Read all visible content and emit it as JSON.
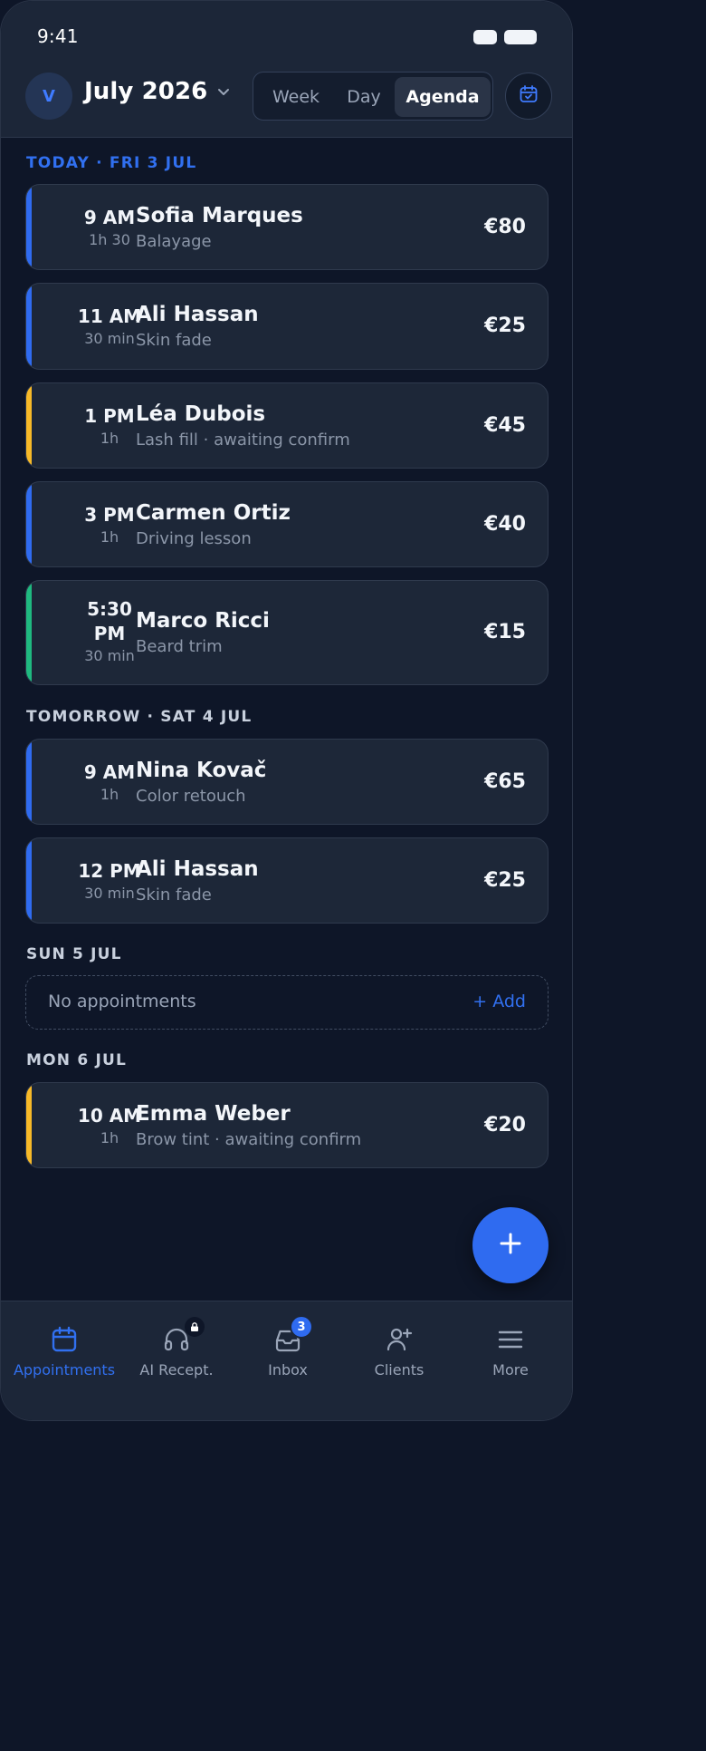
{
  "status_bar": {
    "time": "9:41"
  },
  "header": {
    "avatar_initial": "V",
    "month": "July 2026",
    "views": [
      "Week",
      "Day",
      "Agenda"
    ],
    "active_view": "Agenda"
  },
  "sections": [
    {
      "label": "TODAY · FRI 3 JUL",
      "appointments": [
        {
          "time": "9 AM",
          "duration": "1h 30",
          "client": "Sofia Marques",
          "service": "Balayage",
          "price": "€80",
          "status_color": "#2f6bf0"
        },
        {
          "time": "11 AM",
          "duration": "30 min",
          "client": "Ali Hassan",
          "service": "Skin fade",
          "price": "€25",
          "status_color": "#2f6bf0"
        },
        {
          "time": "1 PM",
          "duration": "1h",
          "client": "Léa Dubois",
          "service": "Lash fill · awaiting confirm",
          "price": "€45",
          "status_color": "#f7b928"
        },
        {
          "time": "3 PM",
          "duration": "1h",
          "client": "Carmen Ortiz",
          "service": "Driving lesson",
          "price": "€40",
          "status_color": "#2f6bf0"
        },
        {
          "time": "5:30 PM",
          "time_line1": "5:30",
          "time_line2": "PM",
          "duration": "30 min",
          "client": "Marco Ricci",
          "service": "Beard trim",
          "price": "€15",
          "status_color": "#1fb980"
        }
      ]
    },
    {
      "label": "TOMORROW · SAT 4 JUL",
      "appointments": [
        {
          "time": "9 AM",
          "duration": "1h",
          "client": "Nina Kovač",
          "service": "Color retouch",
          "price": "€65",
          "status_color": "#2f6bf0"
        },
        {
          "time": "12 PM",
          "duration": "30 min",
          "client": "Ali Hassan",
          "service": "Skin fade",
          "price": "€25",
          "status_color": "#2f6bf0"
        }
      ]
    },
    {
      "label": "SUN 5 JUL",
      "empty_text": "No appointments",
      "add_label": "+ Add"
    },
    {
      "label": "MON 6 JUL",
      "appointments": [
        {
          "time": "10 AM",
          "duration": "1h",
          "client": "Emma Weber",
          "service": "Brow tint · awaiting confirm",
          "price": "€20",
          "status_color": "#f7b928"
        }
      ]
    }
  ],
  "bottom_nav": {
    "items": [
      {
        "label": "Appointments",
        "icon": "calendar-icon",
        "active": true
      },
      {
        "label": "AI Recept.",
        "icon": "headset-icon",
        "locked": true
      },
      {
        "label": "Inbox",
        "icon": "inbox-icon",
        "badge": "3"
      },
      {
        "label": "Clients",
        "icon": "add-person-icon"
      },
      {
        "label": "More",
        "icon": "menu-icon"
      }
    ]
  },
  "colors": {
    "accent": "#2f6bf0",
    "pending": "#f7b928",
    "done": "#1fb980",
    "background": "#0e1628",
    "card": "#1d2738"
  }
}
